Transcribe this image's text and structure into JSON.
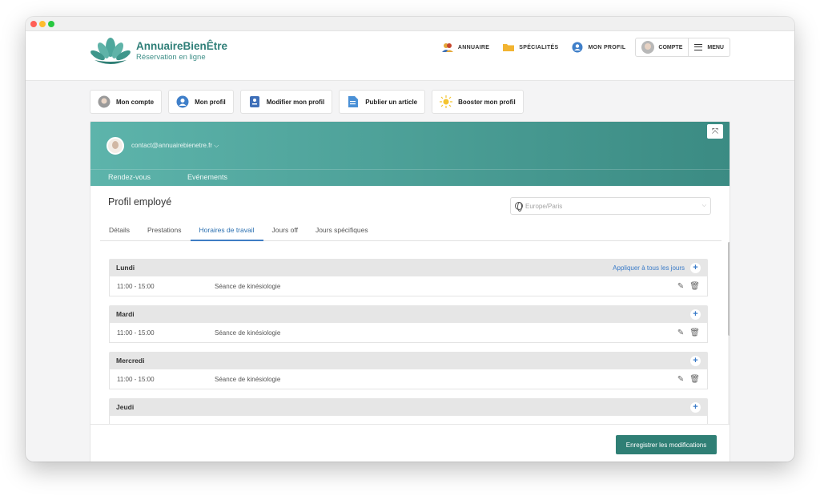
{
  "brand": {
    "title": "AnnuaireBienÊtre",
    "subtitle": "Réservation en ligne"
  },
  "nav": {
    "annuaire": "ANNUAIRE",
    "specialites": "SPÉCIALITÉS",
    "mon_profil": "MON PROFIL",
    "compte": "COMPTE",
    "menu": "MENU"
  },
  "quick": [
    {
      "label": "Mon compte",
      "icon": "avatar-icon"
    },
    {
      "label": "Mon profil",
      "icon": "user-icon"
    },
    {
      "label": "Modifier mon profil",
      "icon": "edit-profile-icon"
    },
    {
      "label": "Publier un article",
      "icon": "document-icon"
    },
    {
      "label": "Booster mon profil",
      "icon": "sparkle-icon"
    }
  ],
  "panel": {
    "email": "contact@annuairebienetre.fr",
    "header_tabs": [
      "Rendez-vous",
      "Evénements"
    ],
    "title": "Profil employé",
    "timezone_placeholder": "Europe/Paris",
    "tabs": [
      "Détails",
      "Prestations",
      "Horaires de travail",
      "Jours off",
      "Jours spécifiques"
    ],
    "active_tab": "Horaires de travail",
    "apply_all": "Appliquer à tous les jours",
    "days": [
      {
        "name": "Lundi",
        "time": "11:00 - 15:00",
        "service": "Séance de kinésiologie"
      },
      {
        "name": "Mardi",
        "time": "11:00 - 15:00",
        "service": "Séance de kinésiologie"
      },
      {
        "name": "Mercredi",
        "time": "11:00 - 15:00",
        "service": "Séance de kinésiologie"
      },
      {
        "name": "Jeudi",
        "time": "",
        "service": ""
      }
    ],
    "save_label": "Enregistrer les modifications"
  },
  "colors": {
    "teal_start": "#5db4ab",
    "teal_end": "#3b8b83",
    "accent_blue": "#3a7bc8",
    "save_button": "#2f7f75"
  }
}
